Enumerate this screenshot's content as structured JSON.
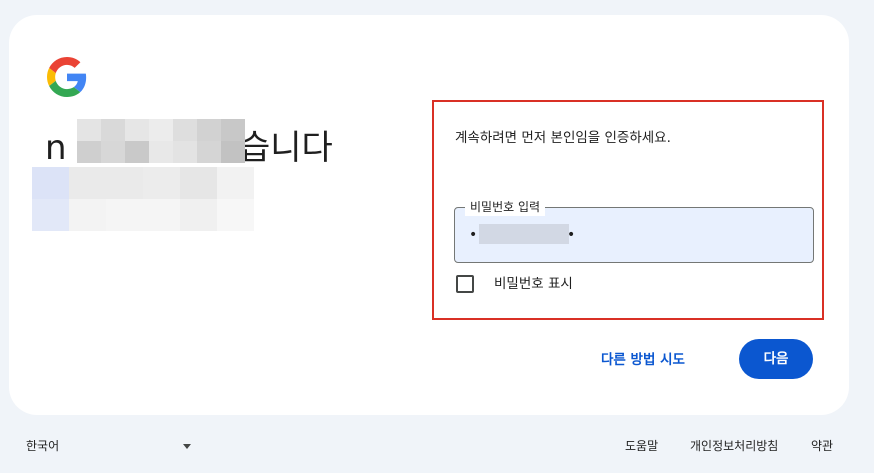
{
  "heading": {
    "visible_start": "n",
    "visible_end": "습니다"
  },
  "verify": {
    "prompt": "계속하려면 먼저 본인임을 인증하세요.",
    "password_label": "비밀번호 입력",
    "password_dot": "•",
    "show_password_label": "비밀번호 표시"
  },
  "actions": {
    "try_other": "다른 방법 시도",
    "next": "다음"
  },
  "footer": {
    "language": "한국어",
    "help": "도움말",
    "privacy": "개인정보처리방침",
    "terms": "약관"
  },
  "colors": {
    "accent": "#0b57d0",
    "highlight": "#d93025",
    "field_bg": "#e8f0fe"
  },
  "icons": {
    "logo": "google-g-logo",
    "language_toggle": "caret-down-icon"
  }
}
